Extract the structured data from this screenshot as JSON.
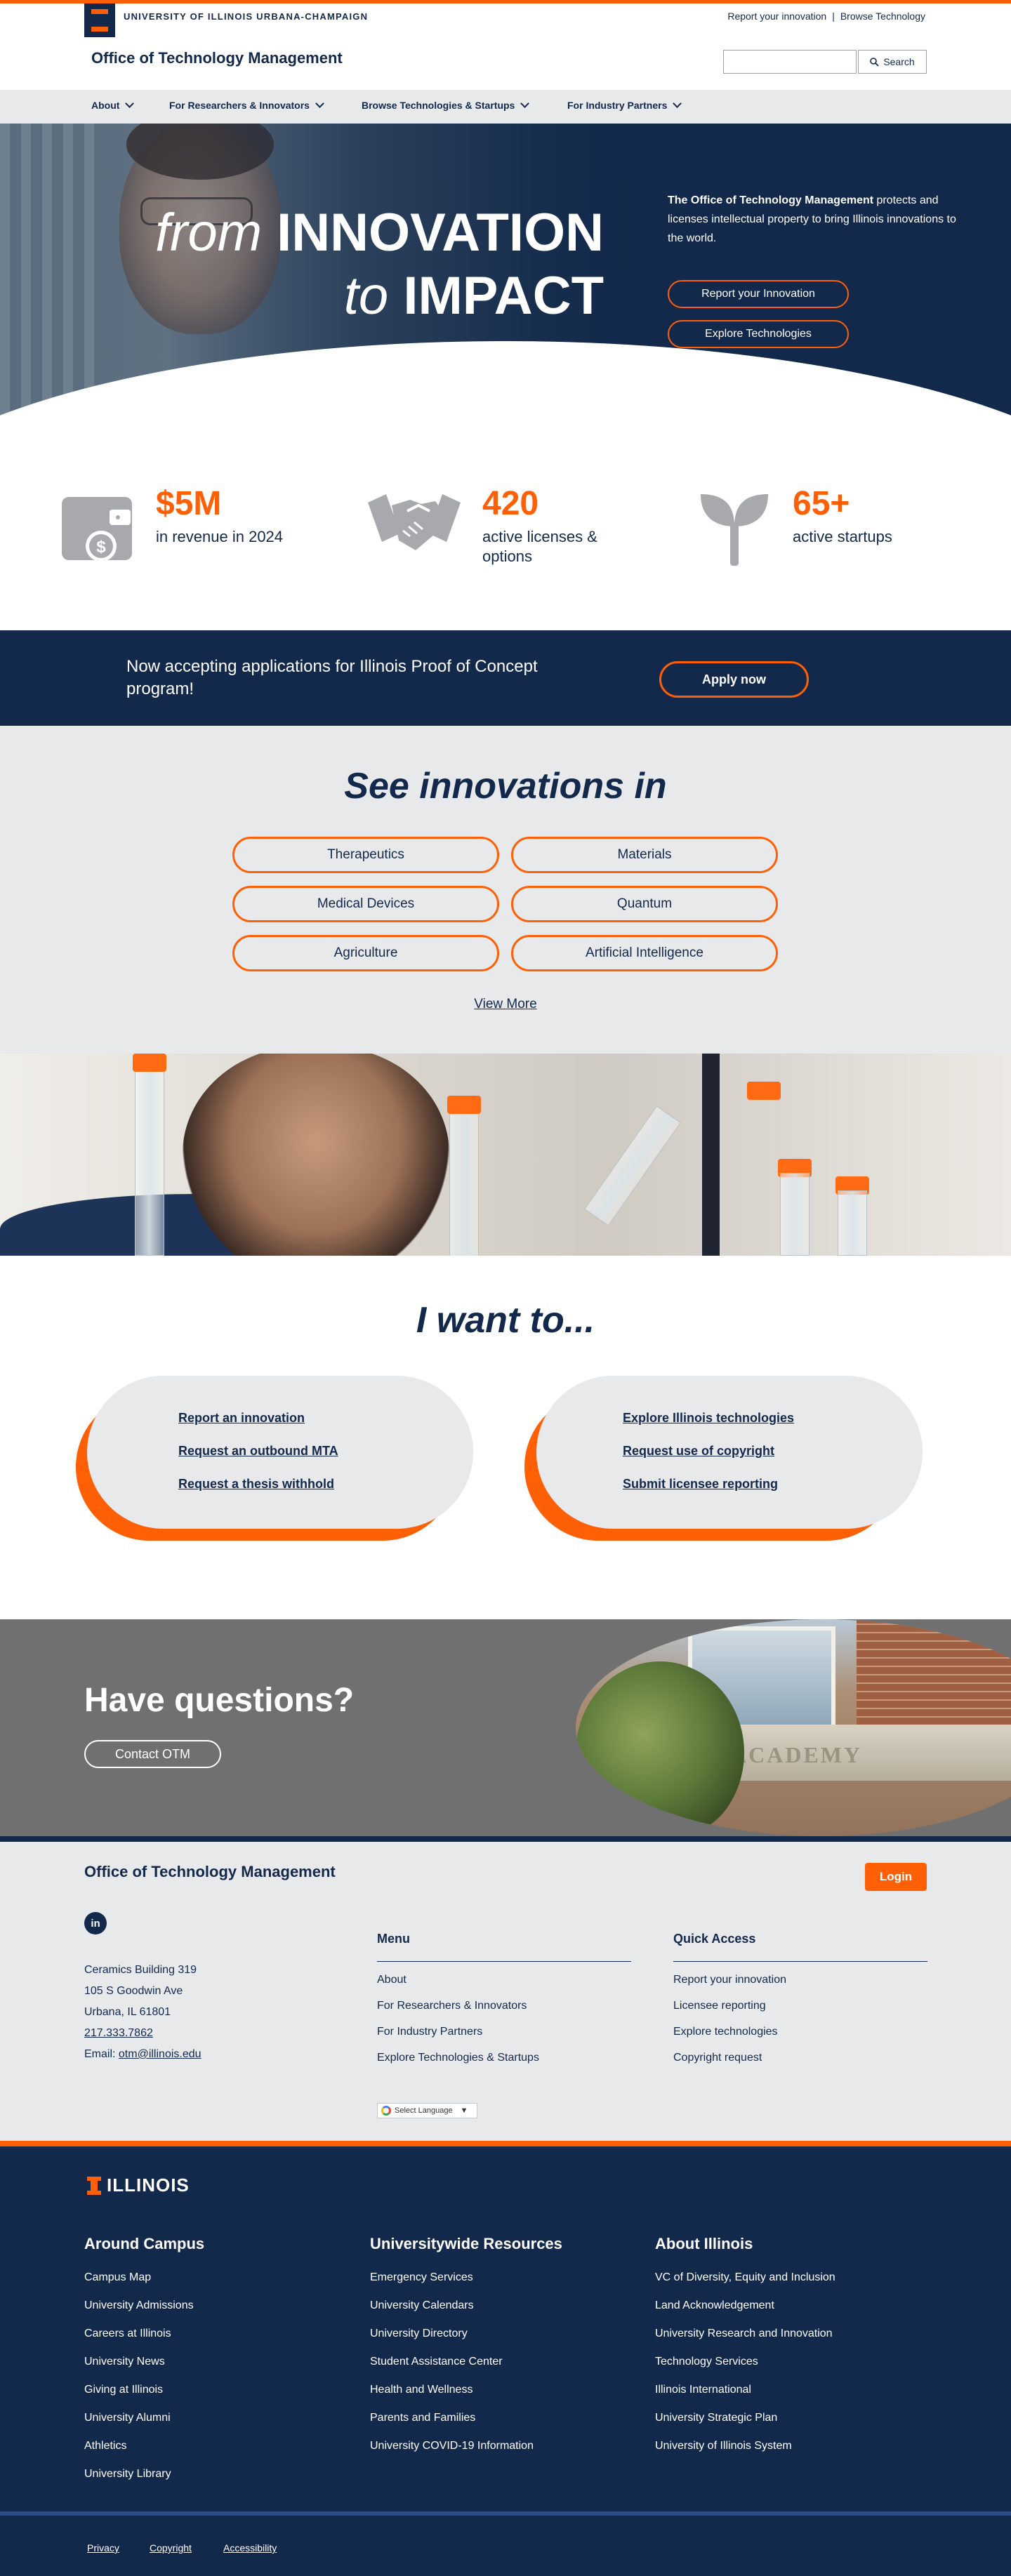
{
  "header": {
    "university": "UNIVERSITY OF ILLINOIS URBANA-CHAMPAIGN",
    "utility_links": [
      "Report your innovation",
      "Browse Technology"
    ],
    "utility_sep": "|",
    "site_title": "Office of Technology Management",
    "search": {
      "value": "",
      "button_label": "Search"
    }
  },
  "nav": {
    "items": [
      {
        "label": "About"
      },
      {
        "label": "For Researchers & Innovators"
      },
      {
        "label": "Browse Technologies & Startups"
      },
      {
        "label": "For Industry Partners"
      }
    ]
  },
  "hero": {
    "line1_italic": "from",
    "line1_bold": "INNOVATION",
    "line2_italic": "to",
    "line2_bold": "IMPACT",
    "desc_bold": "The Office of Technology Management",
    "desc_rest": "protects and licenses intellectual property to bring Illinois innovations to the world.",
    "buttons": [
      "Report your Innovation",
      "Explore Technologies"
    ]
  },
  "stats": [
    {
      "icon": "wallet-icon",
      "value": "$5M",
      "label": "in revenue in 2024"
    },
    {
      "icon": "handshake-icon",
      "value": "420",
      "label": "active licenses & options"
    },
    {
      "icon": "sprout-icon",
      "value": "65+",
      "label": "active startups"
    }
  ],
  "banner": {
    "text": "Now accepting applications for Illinois Proof of Concept program!",
    "button": "Apply now"
  },
  "innovations": {
    "heading": "See innovations in",
    "categories": [
      "Therapeutics",
      "Materials",
      "Medical Devices",
      "Quantum",
      "Agriculture",
      "Artificial Intelligence"
    ],
    "view_more": "View More"
  },
  "want": {
    "heading": "I want to...",
    "left_links": [
      "Report an innovation",
      "Request an outbound MTA",
      "Request a thesis withhold"
    ],
    "right_links": [
      "Explore Illinois technologies",
      "Request use of copyright",
      "Submit licensee reporting"
    ]
  },
  "questions": {
    "heading": "Have questions?",
    "button": "Contact OTM"
  },
  "otm_footer": {
    "title": "Office of Technology Management",
    "login": "Login",
    "linkedin": "in",
    "address": [
      "Ceramics Building 319",
      "105 S Goodwin Ave",
      "Urbana, IL 61801"
    ],
    "phone": "217.333.7862",
    "email_label": "Email:",
    "email": "otm@illinois.edu",
    "menu_heading": "Menu",
    "menu": [
      "About",
      "For Researchers & Innovators",
      "For Industry Partners",
      "Explore Technologies & Startups"
    ],
    "quick_heading": "Quick Access",
    "quick": [
      "Report your innovation",
      "Licensee reporting",
      "Explore technologies",
      "Copyright request"
    ],
    "language": "Select Language"
  },
  "campus_footer": {
    "logo": "ILLINOIS",
    "columns": [
      {
        "heading": "Around Campus",
        "links": [
          "Campus Map",
          "University Admissions",
          "Careers at Illinois",
          "University News",
          "Giving at Illinois",
          "University Alumni",
          "Athletics",
          "University Library"
        ]
      },
      {
        "heading": "Universitywide Resources",
        "links": [
          "Emergency Services",
          "University Calendars",
          "University Directory",
          "Student Assistance Center",
          "Health and Wellness",
          "Parents and Families",
          "University COVID-19 Information"
        ]
      },
      {
        "heading": "About Illinois",
        "links": [
          "VC of Diversity, Equity and Inclusion",
          "Land Acknowledgement",
          "University Research and Innovation",
          "Technology Services",
          "Illinois International",
          "University Strategic Plan",
          "University of Illinois System"
        ]
      }
    ],
    "bottom_links": [
      "Privacy",
      "Copyright",
      "Accessibility"
    ]
  },
  "colors": {
    "navy": "#13294b",
    "orange": "#ff5f05",
    "light_gray": "#e8e9eb"
  }
}
